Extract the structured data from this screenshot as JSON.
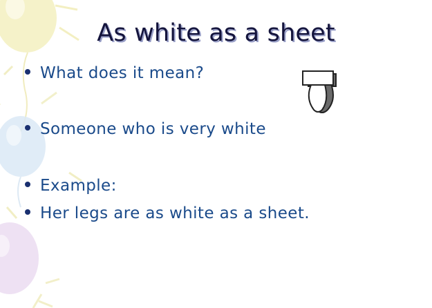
{
  "slide": {
    "title": "As white as a sheet",
    "bullets": [
      {
        "text": "What does it mean?"
      },
      {
        "text": "Someone who is very white"
      },
      {
        "text": "Example:"
      },
      {
        "text": "Her legs are as white as a sheet."
      }
    ],
    "icons": {
      "clip_art": "ghost-sheet-icon",
      "background": "balloons-decoration"
    },
    "colors": {
      "title": "#14143c",
      "title_shadow": "#9aa0c8",
      "bullet_text": "#1a4a8a",
      "bullet_dot": "#1a3070",
      "balloon_yellow": "#f3f0b8",
      "balloon_blue": "#d6e7f6",
      "balloon_purple": "#ead9f0"
    }
  }
}
